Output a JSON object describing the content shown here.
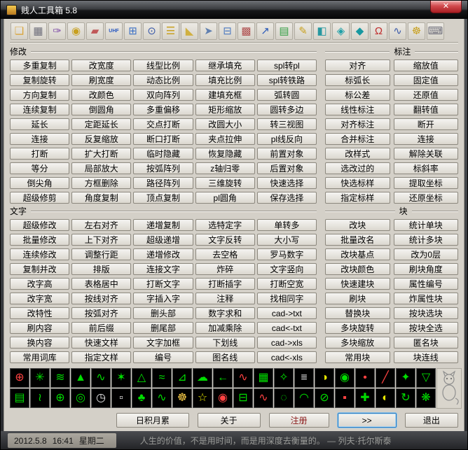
{
  "window": {
    "title": "贱人工具箱 5.8",
    "close_label": "✕"
  },
  "toolbar": {
    "icons": [
      {
        "name": "open-file-icon",
        "glyph": "❏",
        "color": "#d9a53c"
      },
      {
        "name": "print-icon",
        "glyph": "▦",
        "color": "#70707c"
      },
      {
        "name": "brush-icon",
        "glyph": "✑",
        "color": "#8050a8"
      },
      {
        "name": "lock-icon",
        "glyph": "◉",
        "color": "#c8a020"
      },
      {
        "name": "erase-icon",
        "glyph": "▰",
        "color": "#c05858"
      },
      {
        "name": "uhf-tool-icon",
        "glyph": "UHF",
        "color": "#2858c0",
        "small": true
      },
      {
        "name": "calculator-icon",
        "glyph": "⊞",
        "color": "#3a6fc4"
      },
      {
        "name": "zoom-icon",
        "glyph": "⊙",
        "color": "#3858a8"
      },
      {
        "name": "ruler-icon",
        "glyph": "☰",
        "color": "#c8a020"
      },
      {
        "name": "wedge-icon",
        "glyph": "◣",
        "color": "#d0b040"
      },
      {
        "name": "pointer-icon",
        "glyph": "➤",
        "color": "#6080b0"
      },
      {
        "name": "flowchart-icon",
        "glyph": "⊟",
        "color": "#4a78c0"
      },
      {
        "name": "color-table-icon",
        "glyph": "▩",
        "color": "#b05050"
      },
      {
        "name": "export-arrow-icon",
        "glyph": "↗",
        "color": "#2858b8"
      },
      {
        "name": "palette-grid-icon",
        "glyph": "▤",
        "color": "#38a048"
      },
      {
        "name": "edit-note-icon",
        "glyph": "✎",
        "color": "#c8a020"
      },
      {
        "name": "monitor-icon",
        "glyph": "◧",
        "color": "#2898a0"
      },
      {
        "name": "cube-3d-icon",
        "glyph": "◈",
        "color": "#20a0a8"
      },
      {
        "name": "solid-3d-icon",
        "glyph": "◆",
        "color": "#1898a0"
      },
      {
        "name": "magnet-icon",
        "glyph": "Ω",
        "color": "#c03030"
      },
      {
        "name": "probe-icon",
        "glyph": "∿",
        "color": "#3858a8"
      },
      {
        "name": "gear-wheel-icon",
        "glyph": "☸",
        "color": "#c8a020"
      },
      {
        "name": "keyboard-icon",
        "glyph": "⌨",
        "color": "#70707c"
      }
    ]
  },
  "sections": {
    "modify": {
      "label": "修改",
      "buttons": [
        "多重复制",
        "改宽度",
        "线型比例",
        "继承填充",
        "spl转pl",
        "复制旋转",
        "刷宽度",
        "动态比例",
        "填充比例",
        "spl转铁路",
        "方向复制",
        "改颜色",
        "双向阵列",
        "建填充框",
        "弧转圆",
        "连续复制",
        "倒圆角",
        "多重偏移",
        "矩形缩放",
        "圆转多边",
        "延长",
        "定距延长",
        "交点打断",
        "改圆大小",
        "转三视图",
        "连接",
        "反复缩放",
        "断口打断",
        "夹点拉伸",
        "pl线反向",
        "打断",
        "扩大打断",
        "临时隐藏",
        "恢复隐藏",
        "前置对象",
        "等分",
        "局部放大",
        "按弧阵列",
        "z轴归零",
        "后置对象",
        "倒尖角",
        "方框删除",
        "路径阵列",
        "三维旋转",
        "快速选择",
        "超级修剪",
        "角度复制",
        "顶点复制",
        "pl圆角",
        "保存选择"
      ]
    },
    "dimension": {
      "label": "标注",
      "buttons": [
        "对齐",
        "缩放值",
        "标弧长",
        "固定值",
        "标公差",
        "还原值",
        "线性标注",
        "翻转值",
        "对齐标注",
        "断开",
        "合并标注",
        "连接",
        "改样式",
        "解除关联",
        "选改过的",
        "标斜率",
        "快选标样",
        "提取坐标",
        "指定标样",
        "还原坐标"
      ]
    },
    "text": {
      "label": "文字",
      "buttons": [
        "超级修改",
        "左右对齐",
        "递增复制",
        "选特定字",
        "单转多",
        "批量修改",
        "上下对齐",
        "超级递增",
        "文字反转",
        "大小写",
        "连续修改",
        "调整行距",
        "递增修改",
        "去空格",
        "罗马数字",
        "复制并改",
        "排版",
        "连接文字",
        "炸碎",
        "文字竖向",
        "改字高",
        "表格居中",
        "打断文字",
        "打断插字",
        "打断空宽",
        "改字宽",
        "按线对齐",
        "字插入字",
        "注释",
        "找相同字",
        "改特性",
        "按弧对齐",
        "删头部",
        "数字求和",
        "cad->txt",
        "刷内容",
        "前后缀",
        "删尾部",
        "加减乘除",
        "cad<-txt",
        "换内容",
        "快速文样",
        "文字加框",
        "下划线",
        "cad->xls",
        "常用词库",
        "指定文样",
        "编号",
        "图名线",
        "cad<-xls"
      ]
    },
    "block": {
      "label": "块",
      "buttons": [
        "改块",
        "统计单块",
        "批量改名",
        "统计多块",
        "改块基点",
        "改为0层",
        "改块颜色",
        "刷块角度",
        "快速建块",
        "属性编号",
        "刷块",
        "炸属性块",
        "替换块",
        "按块选块",
        "多块旋转",
        "按块全选",
        "多块缩放",
        "匿名块",
        "常用块",
        "块连线"
      ]
    }
  },
  "palette": {
    "rows": [
      [
        {
          "glyph": "⊕",
          "color": "#ff4242"
        },
        {
          "glyph": "✳",
          "color": "#00dd00"
        },
        {
          "glyph": "≋",
          "color": "#00dd00"
        },
        {
          "glyph": "▲",
          "color": "#00dd00"
        },
        {
          "glyph": "∿",
          "color": "#00dd00"
        },
        {
          "glyph": "✶",
          "color": "#00dd00"
        },
        {
          "glyph": "△",
          "color": "#00dd00"
        },
        {
          "glyph": "≈",
          "color": "#00dd00"
        },
        {
          "glyph": "⊿",
          "color": "#00dd00"
        },
        {
          "glyph": "☁",
          "color": "#00dd00"
        },
        {
          "glyph": "←",
          "color": "#00dd00"
        },
        {
          "glyph": "∿",
          "color": "#ff4242"
        },
        {
          "glyph": "▦",
          "color": "#00dd00"
        },
        {
          "glyph": "✧",
          "color": "#00dd00"
        },
        {
          "glyph": "≡",
          "color": "#e8e8e8"
        },
        {
          "glyph": "◑",
          "color": "#e8e800"
        },
        {
          "glyph": "◉",
          "color": "#00dd00"
        },
        {
          "glyph": "•",
          "color": "#ff4242"
        },
        {
          "glyph": "╱",
          "color": "#ff4242"
        },
        {
          "glyph": "✦",
          "color": "#00dd00"
        },
        {
          "glyph": "▽",
          "color": "#00dd00"
        }
      ],
      [
        {
          "glyph": "▤",
          "color": "#00dd00"
        },
        {
          "glyph": "≀",
          "color": "#00dd00"
        },
        {
          "glyph": "⊕",
          "color": "#00dd00"
        },
        {
          "glyph": "◎",
          "color": "#00dd00"
        },
        {
          "glyph": "◷",
          "color": "#e8e8e8"
        },
        {
          "glyph": "▫",
          "color": "#e8e8e8"
        },
        {
          "glyph": "♣",
          "color": "#00dd00"
        },
        {
          "glyph": "∿",
          "color": "#00dd00"
        },
        {
          "glyph": "☸",
          "color": "#ffd24a"
        },
        {
          "glyph": "☆",
          "color": "#e8e800"
        },
        {
          "glyph": "◉",
          "color": "#ff4242"
        },
        {
          "glyph": "⊟",
          "color": "#00dd00"
        },
        {
          "glyph": "∿",
          "color": "#ff4242"
        },
        {
          "glyph": "◌",
          "color": "#00dd00"
        },
        {
          "glyph": "◠",
          "color": "#00dd00"
        },
        {
          "glyph": "⊘",
          "color": "#00dd00"
        },
        {
          "glyph": "▪",
          "color": "#ff4242"
        },
        {
          "glyph": "✚",
          "color": "#00dd00"
        },
        {
          "glyph": "◐",
          "color": "#e8e800"
        },
        {
          "glyph": "↻",
          "color": "#00dd00"
        },
        {
          "glyph": "❋",
          "color": "#00dd00"
        }
      ]
    ]
  },
  "footer": {
    "buttons": [
      {
        "name": "daily-tips-button",
        "label": "日积月累"
      },
      {
        "name": "about-button",
        "label": "关于"
      },
      {
        "name": "register-button",
        "label": "注册",
        "color": "#8b1a1a"
      },
      {
        "name": "more-button",
        "label": ">>",
        "default": true
      },
      {
        "name": "exit-button",
        "label": "退出"
      }
    ]
  },
  "statusbar": {
    "date": "2012.5.8",
    "time": "16:41",
    "weekday": "星期二",
    "quote": "人生的价值，不是用时间，而是用深度去衡量的。",
    "quote_author": "— 列夫·托尔斯泰"
  }
}
